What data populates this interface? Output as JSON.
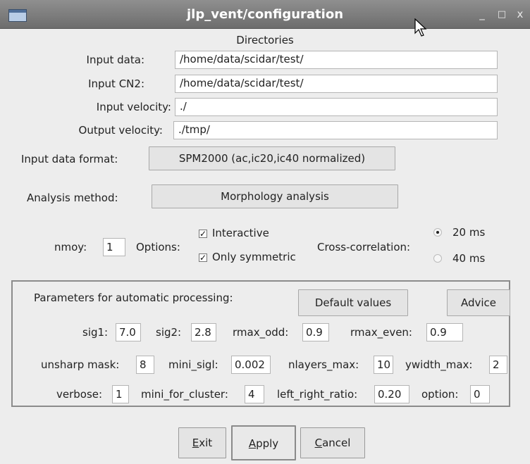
{
  "window": {
    "title": "jlp_vent/configuration",
    "minimize_label": "_",
    "maximize_label": "□",
    "close_label": "x"
  },
  "directories": {
    "heading": "Directories",
    "input_data_label": "Input data:",
    "input_data_value": "/home/data/scidar/test/",
    "input_cn2_label": "Input CN2:",
    "input_cn2_value": "/home/data/scidar/test/",
    "input_velocity_label": "Input velocity:",
    "input_velocity_value": "./",
    "output_velocity_label": "Output velocity:",
    "output_velocity_value": "./tmp/"
  },
  "format": {
    "label": "Input data format:",
    "value": "SPM2000 (ac,ic20,ic40 normalized)"
  },
  "analysis": {
    "label": "Analysis method:",
    "value": "Morphology analysis"
  },
  "options": {
    "nmoy_label": "nmoy:",
    "nmoy_value": "1",
    "options_label": "Options:",
    "interactive_label": "Interactive",
    "interactive_checked": true,
    "only_symmetric_label": "Only symmetric",
    "only_symmetric_checked": true,
    "cross_correlation_label": "Cross-correlation:",
    "cc_20_label": "20 ms",
    "cc_40_label": "40 ms",
    "cc_selected": "20 ms"
  },
  "params": {
    "heading": "Parameters for automatic processing:",
    "default_values_label": "Default values",
    "advice_label": "Advice",
    "sig1_label": "sig1:",
    "sig1_value": "7.0",
    "sig2_label": "sig2:",
    "sig2_value": "2.8",
    "rmax_odd_label": "rmax_odd:",
    "rmax_odd_value": "0.9",
    "rmax_even_label": "rmax_even:",
    "rmax_even_value": "0.9",
    "unsharp_mask_label": "unsharp mask:",
    "unsharp_mask_value": "8",
    "mini_sigl_label": "mini_sigl:",
    "mini_sigl_value": "0.002",
    "nlayers_max_label": "nlayers_max:",
    "nlayers_max_value": "10",
    "ywidth_max_label": "ywidth_max:",
    "ywidth_max_value": "2",
    "verbose_label": "verbose:",
    "verbose_value": "1",
    "mini_for_cluster_label": "mini_for_cluster:",
    "mini_for_cluster_value": "4",
    "left_right_ratio_label": "left_right_ratio:",
    "left_right_ratio_value": "0.20",
    "option_label": "option:",
    "option_value": "0"
  },
  "footer": {
    "exit_mnemonic": "E",
    "exit_rest": "xit",
    "apply_mnemonic": "A",
    "apply_rest": "pply",
    "cancel_mnemonic": "C",
    "cancel_rest": "ancel"
  }
}
